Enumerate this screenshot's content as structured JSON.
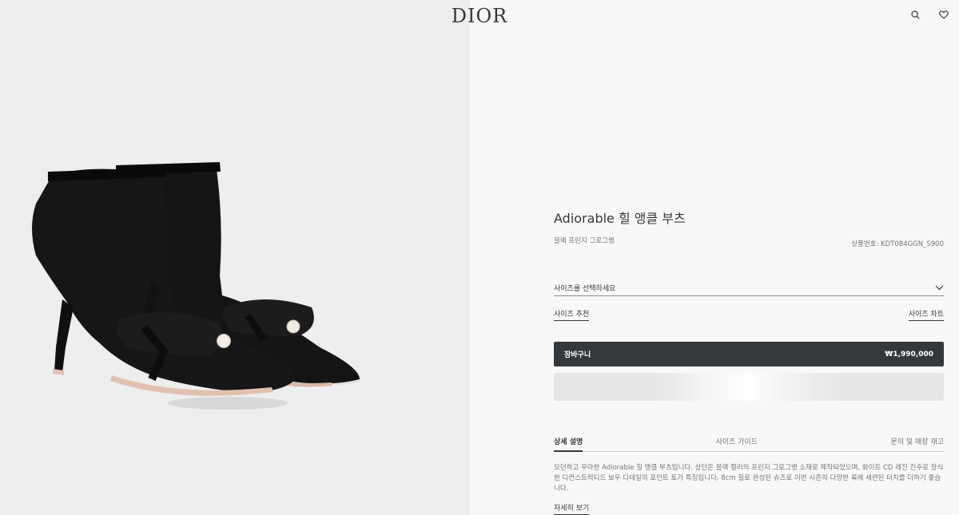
{
  "header": {
    "logo": "DIOR",
    "icons": [
      "search-icon",
      "heart-icon"
    ]
  },
  "product": {
    "title": "Adiorable 힐 앵클 부츠",
    "subtitle": "블랙 프린지 그로그랭",
    "sku": "상품번호: KDT084GGN_S900",
    "size_select_placeholder": "사이즈를 선택하세요",
    "size_recommend": "사이즈 추천",
    "size_chart": "사이즈 차트",
    "cart_label": "장바구니",
    "price": "₩1,990,000"
  },
  "tabs": [
    {
      "label": "상세 설명",
      "active": true
    },
    {
      "label": "사이즈 가이드",
      "active": false
    },
    {
      "label": "문의 및 매장 재고",
      "active": false
    }
  ],
  "description": "모던하고 우아한 Adiorable 힐 앵클 부츠입니다. 상단은 블랙 컬러의 프린지 그로그랭 소재로 제작되었으며, 화이트 CD 레진 진주로 장식한 디컨스트럭티드 보우 디테일의 포인트 토가 특징입니다. 8cm 힐로 완성된 슈즈로 이번 시즌의 다양한 룩에 세련된 터치를 더하기 좋습니다.",
  "more_label": "자세히 보기",
  "colors": {
    "text": "#33383c",
    "muted": "#757575",
    "button": "#33383c",
    "left_bg": "#eeeeee",
    "right_bg": "#f8f8f8"
  }
}
